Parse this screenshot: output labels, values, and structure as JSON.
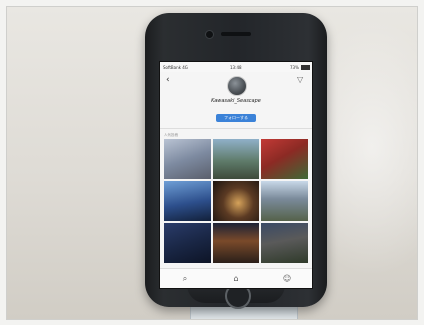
{
  "scene": {
    "description_tag": "photo of smartphone on stand showing app profile"
  },
  "phone": {
    "status": {
      "carrier": "SoftBank 4G",
      "time": "13:48",
      "battery": "73%"
    },
    "profile": {
      "name": "Kawasaki_Seascape",
      "meta": "",
      "follow_label": "フォローする"
    },
    "section_label": "人気投稿",
    "icons": {
      "back": "back-icon",
      "filter": "filter-icon",
      "tab_search": "search-icon",
      "tab_home": "home-icon",
      "tab_profile": "profile-icon"
    },
    "photos": [
      "photo-1",
      "photo-2",
      "photo-3",
      "photo-4",
      "photo-5",
      "photo-6",
      "photo-7",
      "photo-8",
      "photo-9"
    ]
  }
}
